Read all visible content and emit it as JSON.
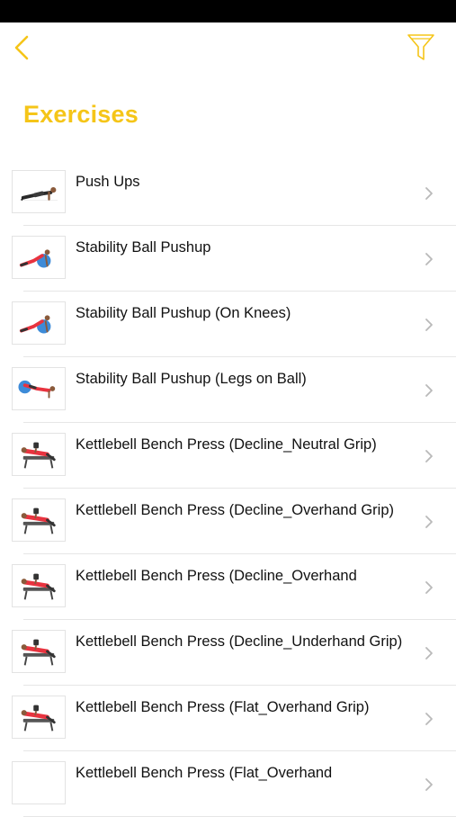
{
  "header": {
    "title": "Exercises"
  },
  "colors": {
    "accent": "#f5c518",
    "figure_red": "#e8333f",
    "ball_blue": "#3d8bd8"
  },
  "icons": {
    "back": "chevron-left-icon",
    "filter": "filter-funnel-icon",
    "row_arrow": "chevron-right-icon"
  },
  "exercises": [
    {
      "name": "Push Ups",
      "thumb": "pushup"
    },
    {
      "name": "Stability Ball Pushup",
      "thumb": "ball"
    },
    {
      "name": "Stability Ball Pushup (On Knees)",
      "thumb": "ball"
    },
    {
      "name": "Stability Ball Pushup (Legs on Ball)",
      "thumb": "ball-legs"
    },
    {
      "name": "Kettlebell Bench Press (Decline_Neutral Grip)",
      "thumb": "bench"
    },
    {
      "name": "Kettlebell Bench Press (Decline_Overhand Grip)",
      "thumb": "bench"
    },
    {
      "name": "Kettlebell Bench Press (Decline_Overhand",
      "thumb": "bench"
    },
    {
      "name": "Kettlebell Bench Press (Decline_Underhand Grip)",
      "thumb": "bench"
    },
    {
      "name": "Kettlebell Bench Press (Flat_Overhand Grip)",
      "thumb": "bench"
    },
    {
      "name": "Kettlebell Bench Press (Flat_Overhand",
      "thumb": "empty"
    }
  ]
}
